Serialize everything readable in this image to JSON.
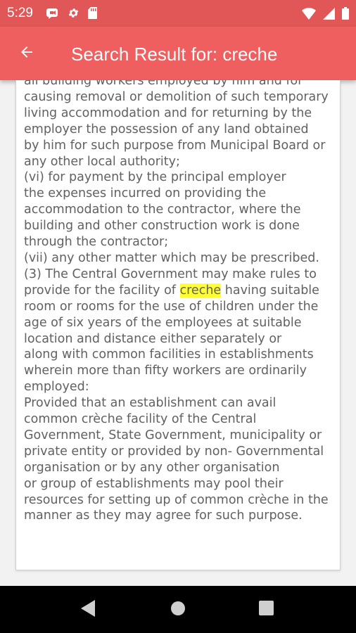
{
  "status_bar": {
    "time": "5:29",
    "icons_left": [
      "video-call-icon",
      "gear-icon",
      "sd-card-icon"
    ],
    "icons_right": [
      "wifi-icon",
      "signal-icon",
      "battery-icon"
    ]
  },
  "app_bar": {
    "back_icon": "arrow-back-icon",
    "title": "Search Result for: creche"
  },
  "document": {
    "lines_before": "all building workers employed by him and for\ncausing removal or demolition of such temporary\nliving accommodation and for returning by the\nemployer the possession of any land obtained\nby him for such purpose from Municipal Board or\nany other local authority;\n(vi) for payment by the principal employer\nthe expenses incurred on providing the\naccommodation to the contractor, where the\nbuilding and other construction work is done\nthrough the contractor;\n(vii) any other matter which may be prescribed.\n(3) The Central Government may make rules to\nprovide for the facility of ",
    "highlight": "creche",
    "lines_after": " having suitable\nroom or rooms for the use of children under the\nage of six years of the employees at suitable\nlocation and distance either separately or\nalong with common facilities in establishments\nwherein more than fifty workers are ordinarily\nemployed:\nProvided that an establishment can avail\ncommon crèche facility of the Central\nGovernment, State Government, municipality or\nprivate entity or provided by non- Governmental\norganisation or by any other organisation\nor group of establishments may pool their\nresources for setting up of common crèche in the\nmanner as they may agree for such purpose.",
    "highlight_color": "#ffff33"
  },
  "nav_bar": {
    "buttons": [
      "back-triangle-icon",
      "home-circle-icon",
      "recents-square-icon"
    ]
  },
  "colors": {
    "status_bar": "#e15757",
    "app_bar": "#ef5f5f",
    "text": "#616161"
  }
}
